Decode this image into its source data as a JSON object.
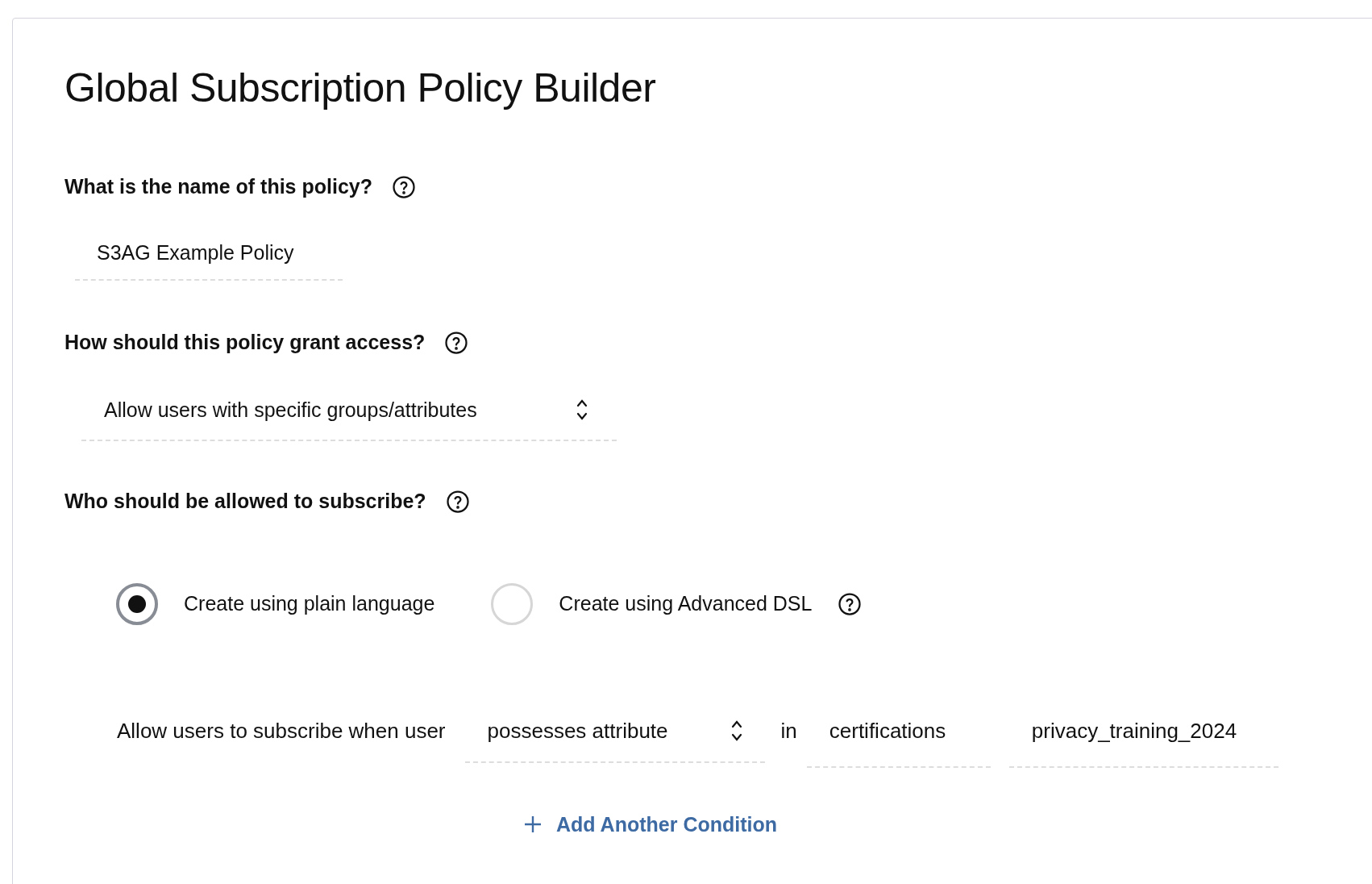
{
  "title": "Global Subscription Policy Builder",
  "name_section": {
    "label": "What is the name of this policy?",
    "value": "S3AG Example Policy"
  },
  "access_section": {
    "label": "How should this policy grant access?",
    "value": "Allow users with specific groups/attributes"
  },
  "subscribe_section": {
    "label": "Who should be allowed to subscribe?",
    "modes": [
      {
        "label": "Create using plain language",
        "selected": true,
        "help": false
      },
      {
        "label": "Create using Advanced DSL",
        "selected": false,
        "help": true
      }
    ],
    "condition": {
      "prefix": "Allow users to subscribe when user",
      "operator": "possesses attribute",
      "joiner": "in",
      "attribute": "certifications",
      "value": "privacy_training_2024"
    },
    "add_condition": "Add Another Condition"
  }
}
